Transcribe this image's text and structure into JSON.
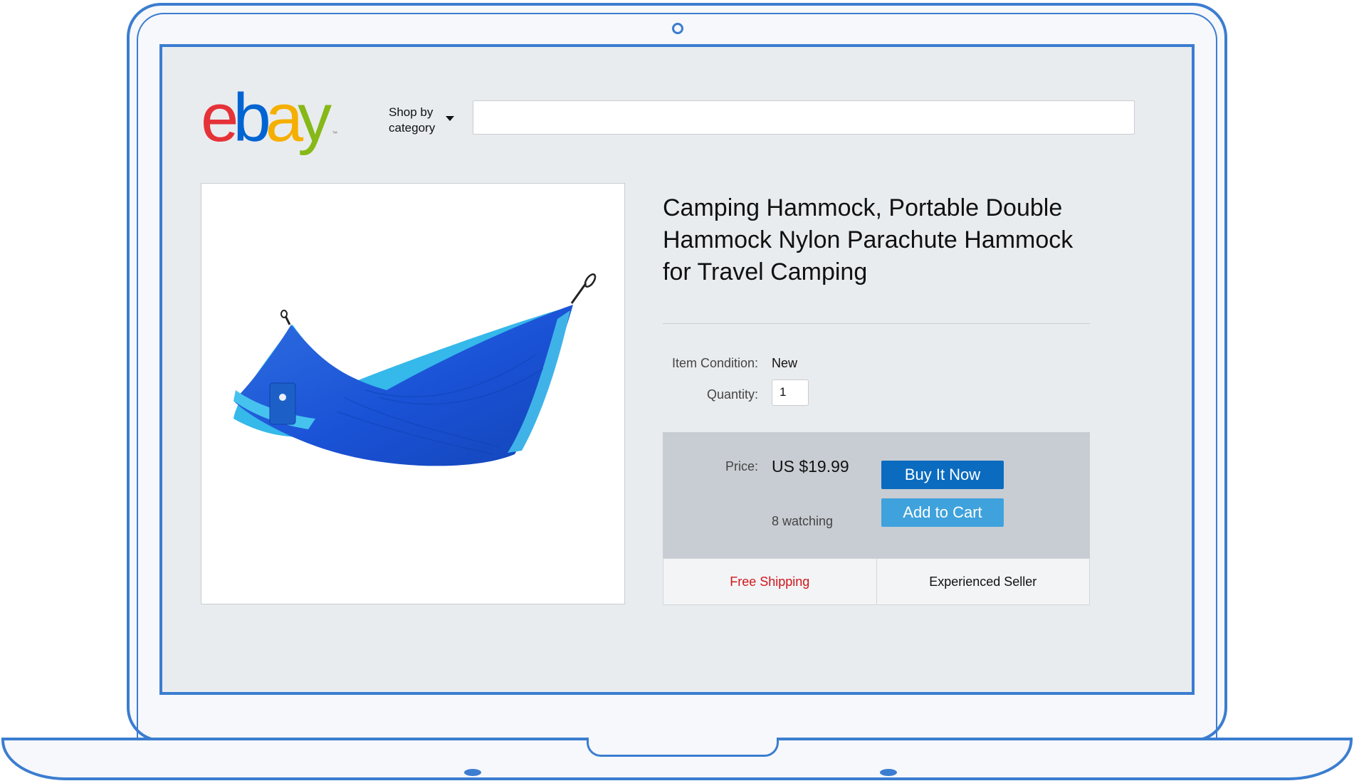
{
  "header": {
    "logo_letters": [
      {
        "char": "e",
        "color": "#e53238"
      },
      {
        "char": "b",
        "color": "#0064d2"
      },
      {
        "char": "a",
        "color": "#f5af02"
      },
      {
        "char": "y",
        "color": "#86b817"
      }
    ],
    "logo_tm": "™",
    "shop_by_line1": "Shop by",
    "shop_by_line2": "category",
    "search_value": ""
  },
  "product": {
    "title_line1": "Camping Hammock, Portable Double",
    "title_line2": "Hammock Nylon Parachute Hammock",
    "title_line3": "for Travel Camping",
    "condition_label": "Item Condition:",
    "condition_value": "New",
    "quantity_label": "Quantity:",
    "quantity_value": "1",
    "image_icon": "hammock-image"
  },
  "purchase": {
    "price_label": "Price:",
    "price_value": "US $19.99",
    "watching": "8 watching",
    "buy_now_label": "Buy It Now",
    "add_to_cart_label": "Add to Cart",
    "buy_now_color": "#0b6bbf",
    "add_to_cart_color": "#3fa2dc"
  },
  "badges": {
    "free_shipping": "Free Shipping",
    "experienced_seller": "Experienced Seller",
    "free_shipping_color": "#d0161b"
  },
  "frame": {
    "device": "laptop-frame",
    "accent_color": "#3b7dd0"
  }
}
